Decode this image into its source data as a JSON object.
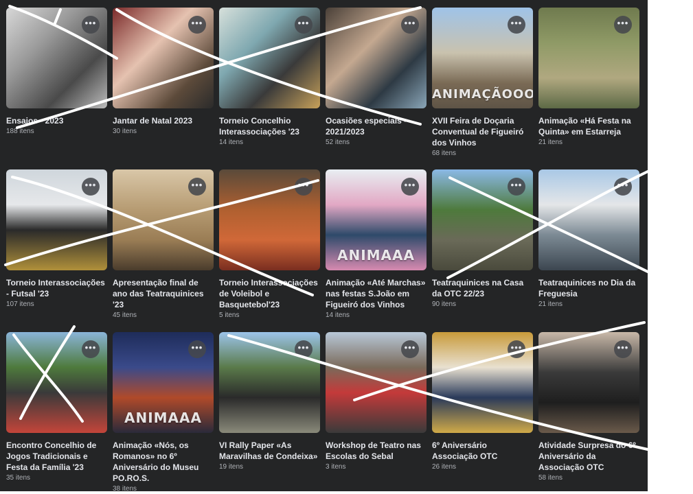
{
  "albums": [
    {
      "title": "Ensaios - 2023",
      "count": "188 itens",
      "watermark": "",
      "bg": "linear-gradient(135deg,#d8d8d8 0%,#9a9a9a 35%,#4a4a4a 70%,#bcbcbc 100%)"
    },
    {
      "title": "Jantar de Natal 2023",
      "count": "30 itens",
      "watermark": "",
      "bg": "linear-gradient(135deg,#7b2a2a 0%,#e5c2b0 40%,#5c4a3a 75%,#2b2b2b 100%)"
    },
    {
      "title": "Torneio Concelhio Interassociações '23",
      "count": "14 itens",
      "watermark": "",
      "bg": "linear-gradient(135deg,#d7e0db 0%,#7fa8b0 35%,#3a3a3a 65%,#c7a15a 100%)"
    },
    {
      "title": "Ocasiões especiais - 2021/2023",
      "count": "52 itens",
      "watermark": "",
      "bg": "linear-gradient(135deg,#4a4038 0%,#c4a890 40%,#2e3a44 70%,#8aa6b8 100%)"
    },
    {
      "title": "XVII Feira de Doçaria Conventual de Figueiró dos Vinhos",
      "count": "68 itens",
      "watermark": "ANIMAÇÃOOOOOO",
      "bg": "linear-gradient(180deg,#9fc3e8 0%,#c9c2ae 45%,#7a6a55 75%,#5e5446 100%)"
    },
    {
      "title": "Animação «Há Festa na Quinta» em Estarreja",
      "count": "21 itens",
      "watermark": "",
      "bg": "linear-gradient(180deg,#6f7a4e 0%,#8f9a66 35%,#b0a880 70%,#5d6a46 100%)"
    },
    {
      "title": "Torneio Interassociações - Futsal '23",
      "count": "107 itens",
      "watermark": "",
      "bg": "linear-gradient(180deg,#cfd6dc 0%,#e6e8ea 35%,#2a2a2a 60%,#b0903a 100%)"
    },
    {
      "title": "Apresentação final de ano das Teatraquinices '23",
      "count": "45 itens",
      "watermark": "",
      "bg": "linear-gradient(180deg,#d9c7a8 0%,#b69b72 40%,#9a7d55 70%,#4a3c2c 100%)"
    },
    {
      "title": "Torneio Interassociações de Voleibol e Basquetebol'23",
      "count": "5 itens",
      "watermark": "",
      "bg": "linear-gradient(180deg,#5a4a3a 0%,#b06030 40%,#d06838 70%,#7a2e20 100%)"
    },
    {
      "title": "Animação «Até Marchas» nas festas S.João em Figueiró dos Vinhos",
      "count": "14 itens",
      "watermark": "ANIMAAA",
      "bg": "linear-gradient(180deg,#e8eef2 0%,#e2a8c4 35%,#2e4a6a 65%,#d78ab0 100%)"
    },
    {
      "title": "Teatraquinices na Casa da OTC 22/23",
      "count": "90 itens",
      "watermark": "",
      "bg": "linear-gradient(180deg,#8bb9e6 0%,#4e7a3c 40%,#6a6a58 70%,#4a4a3c 100%)"
    },
    {
      "title": "Teatraquinices no Dia da Freguesia",
      "count": "21 itens",
      "watermark": "",
      "bg": "linear-gradient(180deg,#a9c8e6 0%,#e4e6e8 35%,#7c8a94 65%,#3c4650 100%)"
    },
    {
      "title": "Encontro Concelhio de Jogos Tradicionais e Festa da Família '23",
      "count": "35 itens",
      "watermark": "",
      "bg": "linear-gradient(180deg,#8ab4d8 0%,#4e7a3c 35%,#3a3a3a 60%,#c4453a 100%)"
    },
    {
      "title": "Animação «Nós, os Romanos» no 6º Aniversário do Museu PO.RO.S.",
      "count": "38 itens",
      "watermark": "ANIMAAA",
      "bg": "linear-gradient(180deg,#1e2c5a 0%,#3a4a8a 35%,#b04a2a 65%,#2a2a3a 100%)"
    },
    {
      "title": "VI Rally Paper «As Maravilhas de Condeixa»",
      "count": "19 itens",
      "watermark": "",
      "bg": "linear-gradient(180deg,#9cc4ea 0%,#5a7a4a 35%,#2a2a2a 65%,#8a8a7a 100%)"
    },
    {
      "title": "Workshop de Teatro nas Escolas do Sebal",
      "count": "3 itens",
      "watermark": "",
      "bg": "linear-gradient(180deg,#b8c8d8 0%,#7a6a5a 35%,#c43a3a 60%,#3a3a3a 100%)"
    },
    {
      "title": "6º Aniversário Associação OTC",
      "count": "26 itens",
      "watermark": "",
      "bg": "linear-gradient(180deg,#c89a3a 0%,#e8e0d0 35%,#2a3a5a 65%,#d0aa48 100%)"
    },
    {
      "title": "Atividade Surpresa do 6º Aniversário da Associação OTC",
      "count": "58 itens",
      "watermark": "",
      "bg": "linear-gradient(180deg,#c8b8a8 0%,#3a3a3a 40%,#1e1e1e 70%,#6a5a4a 100%)"
    }
  ],
  "more_glyph": "•••",
  "stroke_color": "#ffffff"
}
